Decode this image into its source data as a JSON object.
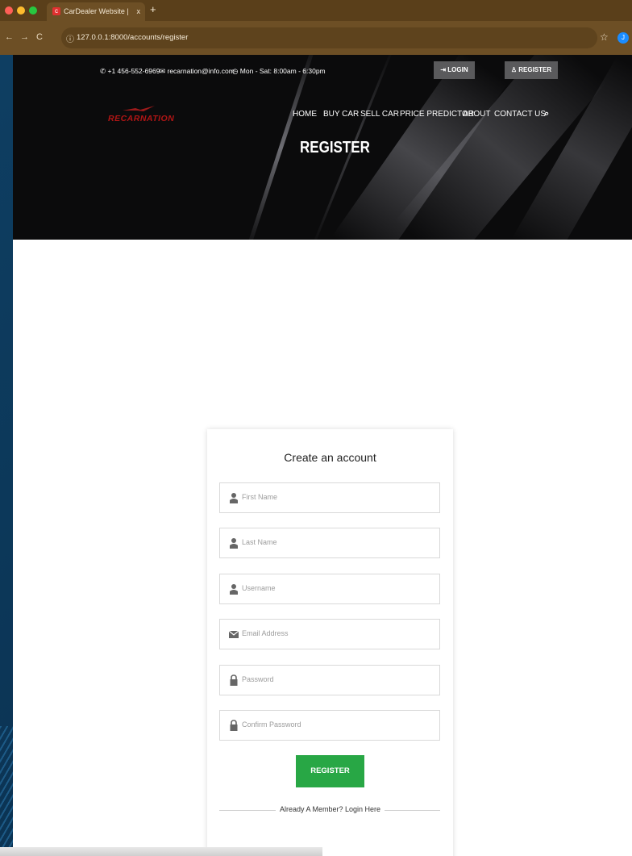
{
  "browser": {
    "tab_title": "CarDealer Website | Register",
    "tab_close": "x",
    "new_tab": "+",
    "back": "←",
    "forward": "→",
    "reload": "C",
    "url_icon": "ⓘ",
    "url": "127.0.0.1:8000/accounts/register",
    "profile_initial": "J"
  },
  "topbar": {
    "phone": "+1 456-552-6969",
    "email": "recarnation@info.com",
    "hours": "Mon - Sat: 8:00am - 6:30pm",
    "login_label": "LOGIN",
    "register_label": "REGISTER"
  },
  "brand": {
    "logo_text": "RECARNATION"
  },
  "menu": {
    "items": [
      "HOME",
      "BUY CAR",
      "SELL CAR",
      "PRICE PREDICTOR",
      "ABOUT",
      "CONTACT US"
    ]
  },
  "page_heading": "REGISTER",
  "form": {
    "title": "Create an account",
    "fields": [
      {
        "placeholder": "First Name",
        "icon": "user-icon"
      },
      {
        "placeholder": "Last Name",
        "icon": "user-icon"
      },
      {
        "placeholder": "Username",
        "icon": "user-icon"
      },
      {
        "placeholder": "Email Address",
        "icon": "envelope-icon"
      },
      {
        "placeholder": "Password",
        "icon": "lock-icon"
      },
      {
        "placeholder": "Confirm Password",
        "icon": "lock-icon"
      }
    ],
    "submit_label": "REGISTER",
    "already_member": "Already A Member?  Login Here"
  },
  "colors": {
    "accent_green": "#28a745",
    "logo_red": "#b01515",
    "header_button": "#5a5a5c"
  }
}
